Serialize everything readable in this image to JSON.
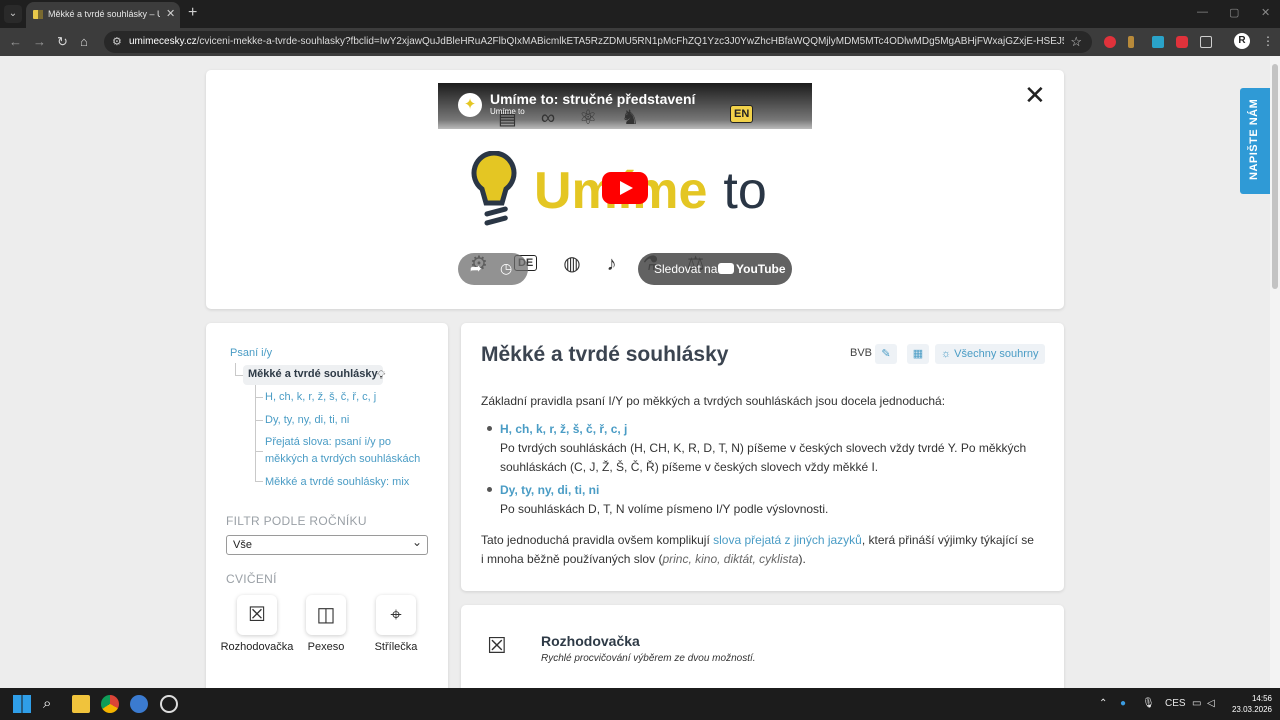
{
  "browser": {
    "tab_title": "Měkké a tvrdé souhlásky – Umí",
    "url_host": "umimecesky.cz",
    "url_rest": "/cviceni-mekke-a-tvrde-souhlasky?fbclid=IwY2xjawQuJdBleHRuA2FlbQIxMABicmlkETA5RzZDMU5RN1pMcFhZQ1Yzc3J0YwZhcHBfaWQQMjlyMDM5MTc4ODlwMDg5MgABHjFWxajGZxjE-HSEJ5VC3GL4ccLSD5I1V...",
    "profile_initial": "R"
  },
  "video": {
    "title": "Umíme to: stručné představení",
    "channel": "Umíme to",
    "brand_main": "Umíme",
    "brand_to": "to",
    "watch_on": "Sledovat na",
    "youtube": "YouTube",
    "lang_top": "EN",
    "lang_bottom": "DE"
  },
  "sidebar": {
    "root": "Psaní i/y",
    "current": "Měkké a tvrdé souhlásky",
    "subitems": [
      "H, ch, k, r, ž, š, č, ř, c, j",
      "Dy, ty, ny, di, ti, ni",
      "Přejatá slova: psaní i/y po",
      "měkkých a tvrdých souhláskách",
      "Měkké a tvrdé souhlásky: mix"
    ],
    "filter_label": "FILTR PODLE ROČNÍKU",
    "filter_value": "Vše",
    "exercises_label": "CVIČENÍ",
    "exercises": [
      "Rozhodovačka",
      "Pexeso",
      "Střílečka"
    ]
  },
  "article": {
    "title": "Měkké a tvrdé souhlásky",
    "bvb": "BVB",
    "all_summaries": "Všechny souhrny",
    "intro": "Základní pravidla psaní I/Y po měkkých a tvrdých souhláskách jsou docela jednoduchá:",
    "rule1_head": "H, ch, k, r, ž, š, č, ř, c, j",
    "rule1_line1": "Po tvrdých souhláskách (H, CH, K, R, D, T, N) píšeme v českých slovech vždy tvrdé Y. Po měkkých",
    "rule1_line2": "souhláskách (C, J, Ž, Š, Č, Ř) píšeme v českých slovech vždy měkké I.",
    "rule2_head": "Dy, ty, ny, di, ti, ni",
    "rule2_text": "Po souhláskách D, T, N volíme písmeno I/Y podle výslovnosti.",
    "outro_a": "Tato jednoduchá pravidla ovšem komplikují ",
    "outro_link": "slova přejatá z jiných jazyků",
    "outro_b": ", která přináší výjimky týkající se",
    "outro_c": "i mnoha běžně používaných slov (",
    "outro_examples": "princ, kino, diktát, cyklista",
    "outro_d": ")."
  },
  "activity": {
    "title": "Rozhodovačka",
    "subtitle": "Rychlé procvičování výběrem ze dvou možností."
  },
  "feedback": "NAPIŠTE NÁM",
  "taskbar": {
    "lang": "CES",
    "time": "14:56",
    "date": "23.03.2026"
  }
}
